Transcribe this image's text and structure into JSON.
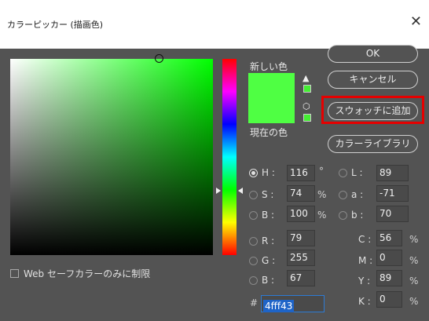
{
  "window": {
    "title": "カラーピッカー (描画色)",
    "close_glyph": "✕"
  },
  "labels": {
    "new": "新しい色",
    "current": "現在の色"
  },
  "colors": {
    "new": "#4fff43",
    "current": "#4fff43",
    "field_hue": "#00ff00"
  },
  "icons": {
    "gamut_warning": "warning-icon",
    "web_warning": "cube-icon"
  },
  "buttons": {
    "ok": "OK",
    "cancel": "キャンセル",
    "add_to_swatches": "スウォッチに追加",
    "color_libraries": "カラーライブラリ"
  },
  "fields": {
    "H": {
      "label": "H :",
      "value": "116",
      "unit": "°",
      "selected": true
    },
    "S": {
      "label": "S :",
      "value": "74",
      "unit": "%"
    },
    "B": {
      "label": "B :",
      "value": "100",
      "unit": "%"
    },
    "R": {
      "label": "R :",
      "value": "79"
    },
    "G": {
      "label": "G :",
      "value": "255"
    },
    "B2": {
      "label": "B :",
      "value": "67"
    },
    "L": {
      "label": "L :",
      "value": "89"
    },
    "a": {
      "label": "a :",
      "value": "-71"
    },
    "b": {
      "label": "b :",
      "value": "70"
    },
    "C": {
      "label": "C :",
      "value": "56",
      "unit": "%"
    },
    "M": {
      "label": "M :",
      "value": "0",
      "unit": "%"
    },
    "Y": {
      "label": "Y :",
      "value": "89",
      "unit": "%"
    },
    "K": {
      "label": "K :",
      "value": "0",
      "unit": "%"
    }
  },
  "hex": {
    "sign": "#",
    "value": "4fff43"
  },
  "websafe": {
    "label": "Web セーフカラーのみに制限",
    "checked": false
  }
}
